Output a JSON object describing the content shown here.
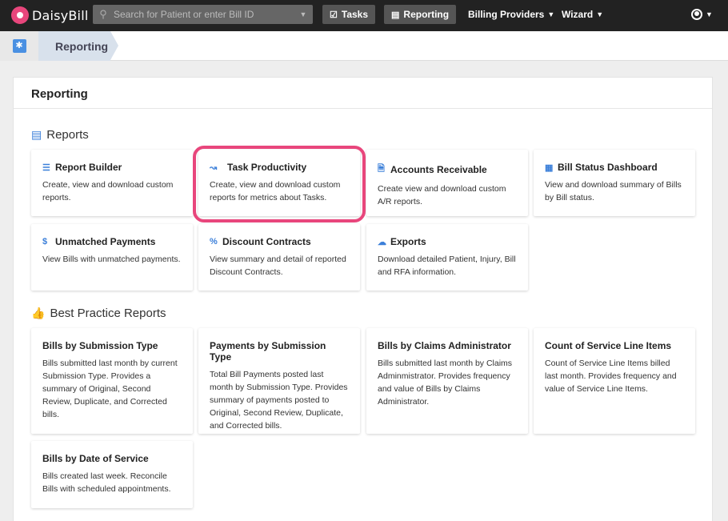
{
  "app": {
    "logo_text": "DaisyBill"
  },
  "search": {
    "placeholder": "Search for Patient or enter Bill ID"
  },
  "nav": {
    "tasks_label": "Tasks",
    "reporting_label": "Reporting",
    "billing_providers_label": "Billing Providers",
    "wizard_label": "Wizard"
  },
  "breadcrumb": {
    "current": "Reporting"
  },
  "panel": {
    "title": "Reporting"
  },
  "reports": {
    "section_title": "Reports",
    "cards": [
      {
        "title": "Report Builder",
        "icon": "sliders-icon",
        "desc": "Create, view and download custom reports."
      },
      {
        "title": "Task Productivity",
        "icon": "line-chart-icon",
        "desc": "Create, view and download custom reports for metrics about Tasks."
      },
      {
        "title": "Accounts Receivable",
        "icon": "file-icon",
        "desc": "Create view and download custom A/R reports."
      },
      {
        "title": "Bill Status Dashboard",
        "icon": "table-icon",
        "desc": "View and download summary of Bills by Bill status."
      },
      {
        "title": "Unmatched Payments",
        "icon": "dollar-icon",
        "desc": "View Bills with unmatched payments."
      },
      {
        "title": "Discount Contracts",
        "icon": "percent-icon",
        "desc": "View summary and detail of reported Discount Contracts."
      },
      {
        "title": "Exports",
        "icon": "cloud-download-icon",
        "desc": "Download detailed Patient, Injury, Bill and RFA information."
      }
    ]
  },
  "best_practice": {
    "section_title": "Best Practice Reports",
    "cards": [
      {
        "title": "Bills by Submission Type",
        "desc": "Bills submitted last month by current Submission Type. Provides a summary of Original, Second Review, Duplicate, and Corrected bills."
      },
      {
        "title": "Payments by Submission Type",
        "desc": "Total Bill Payments posted last month by Submission Type. Provides summary of payments posted to Original, Second Review, Duplicate, and Corrected bills."
      },
      {
        "title": "Bills by Claims Administrator",
        "desc": "Bills submitted last month by Claims Adminmistrator. Provides frequency and value of Bills by Claims Administrator."
      },
      {
        "title": "Count of Service Line Items",
        "desc": "Count of Service Line Items billed last month. Provides frequency and value of Service Line Items."
      },
      {
        "title": "Bills by Date of Service",
        "desc": "Bills created last week. Reconcile Bills with scheduled appointments."
      }
    ]
  },
  "colors": {
    "accent": "#3b7fd9",
    "highlight": "#e8467c",
    "navbar": "#222222"
  }
}
